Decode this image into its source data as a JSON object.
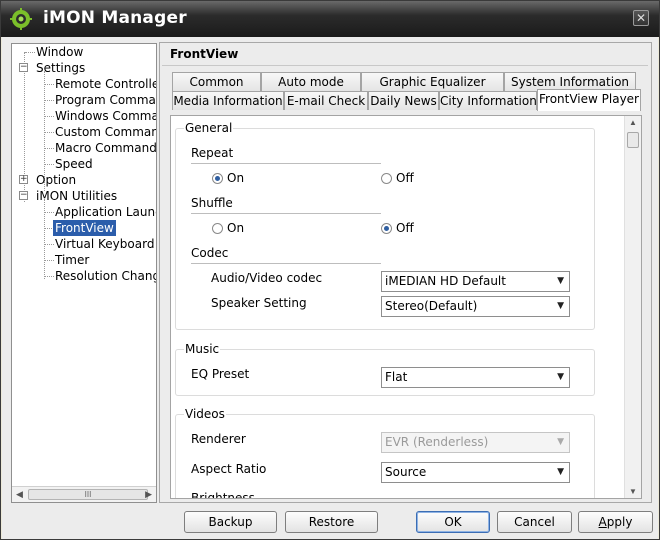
{
  "window": {
    "title": "iMON Manager",
    "close_glyph": "✕"
  },
  "tree": {
    "items": [
      {
        "label": "Window"
      },
      {
        "label": "Settings",
        "expander": "−"
      },
      {
        "label": "Remote Controller"
      },
      {
        "label": "Program Command"
      },
      {
        "label": "Windows Command"
      },
      {
        "label": "Custom Command"
      },
      {
        "label": "Macro Command"
      },
      {
        "label": "Speed"
      },
      {
        "label": "Option",
        "expander": "+"
      },
      {
        "label": "iMON Utilities",
        "expander": "−"
      },
      {
        "label": "Application Launcher"
      },
      {
        "label": "FrontView",
        "selected": true
      },
      {
        "label": "Virtual Keyboard"
      },
      {
        "label": "Timer"
      },
      {
        "label": "Resolution Changer"
      }
    ],
    "scroll_left": "◀",
    "scroll_right": "▶",
    "scroll_grip": "III"
  },
  "panel": {
    "title": "FrontView",
    "tabs_row1": [
      "Common",
      "Auto mode",
      "Graphic Equalizer",
      "System Information"
    ],
    "tabs_row2": [
      "Media Information",
      "E-mail Check",
      "Daily News",
      "City Information",
      "FrontView Player"
    ],
    "active_tab": "FrontView Player"
  },
  "general": {
    "title": "General",
    "repeat": {
      "label": "Repeat",
      "on": "On",
      "off": "Off",
      "value": "On"
    },
    "shuffle": {
      "label": "Shuffle",
      "on": "On",
      "off": "Off",
      "value": "Off"
    },
    "codec": {
      "label": "Codec",
      "av_label": "Audio/Video codec",
      "av_value": "iMEDIAN HD Default",
      "speaker_label": "Speaker Setting",
      "speaker_value": "Stereo(Default)"
    }
  },
  "music": {
    "title": "Music",
    "eq_label": "EQ Preset",
    "eq_value": "Flat"
  },
  "videos": {
    "title": "Videos",
    "renderer_label": "Renderer",
    "renderer_value": "EVR (Renderless)",
    "aspect_label": "Aspect Ratio",
    "aspect_value": "Source",
    "brightness_label": "Brightness"
  },
  "scroll": {
    "up": "▲",
    "down": "▼"
  },
  "buttons": {
    "backup": "Backup",
    "restore": "Restore",
    "ok": "OK",
    "cancel": "Cancel",
    "apply_mnemonic": "A",
    "apply_rest": "pply"
  },
  "colors": {
    "selection": "#2b5dab",
    "titlebar": "#1b1b1b",
    "radio_dot": "#2f5ea0"
  }
}
